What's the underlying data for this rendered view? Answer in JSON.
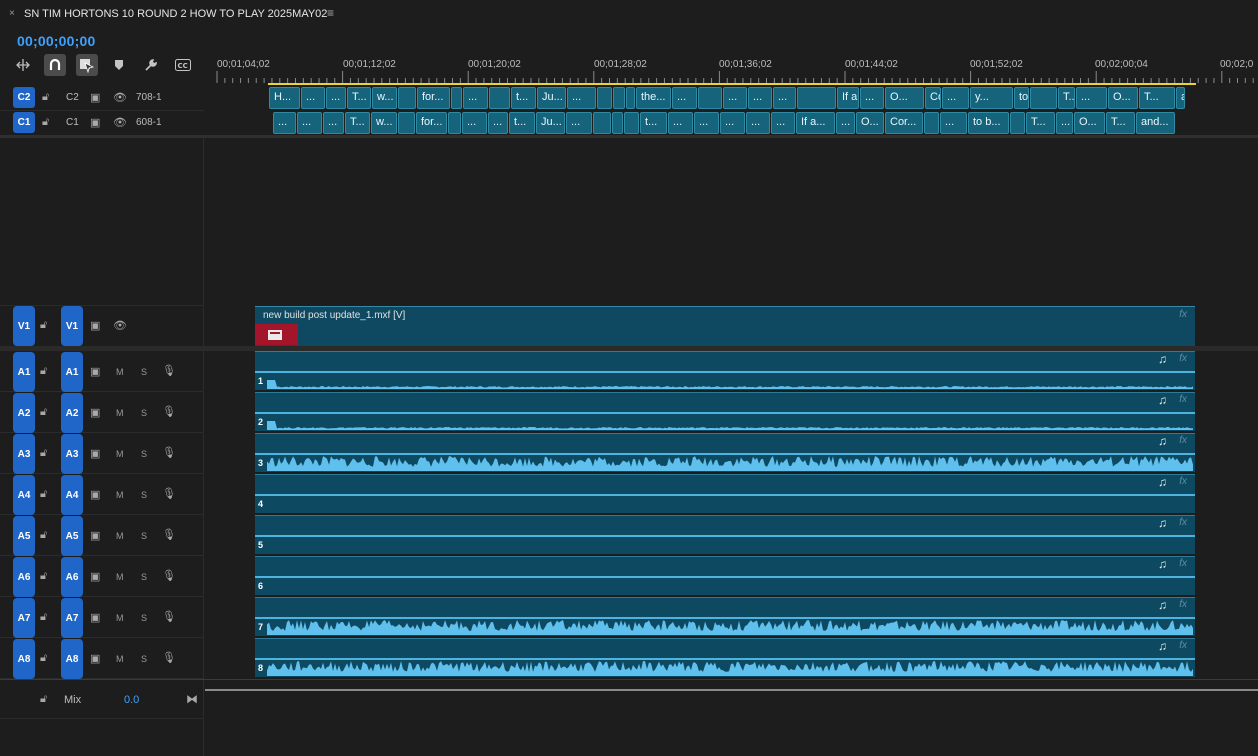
{
  "sequence": {
    "close": "×",
    "title": "SN TIM HORTONS 10 ROUND 2 HOW TO PLAY 2025MAY02",
    "menu_icon": "≡"
  },
  "timecode": "00;00;00;00",
  "toolbar": {
    "icons": [
      "insert-overwrite-icon",
      "snap-icon",
      "linked-selection-icon",
      "add-marker-icon",
      "settings-wrench-icon",
      "captions-icon"
    ]
  },
  "ruler": {
    "labels": [
      "00;01;04;02",
      "00;01;12;02",
      "00;01;20;02",
      "00;01;28;02",
      "00;01;36;02",
      "00;01;44;02",
      "00;01;52;02",
      "00;02;00;04",
      "00;02;0"
    ]
  },
  "caption_tracks": [
    {
      "target": "C2",
      "label": "C2",
      "name": "708-1",
      "clips": [
        "H...",
        "...",
        "...",
        "T...",
        "w...",
        "",
        "for...",
        "",
        "...",
        "",
        "t...",
        "Ju...",
        "...",
        "",
        "",
        "",
        "the...",
        "...",
        "",
        "...",
        "...",
        "...",
        "",
        "If a...",
        "...",
        "O...",
        "Cor...",
        "...",
        "y...",
        "to b...",
        "",
        "T...",
        "...",
        "O...",
        "T...",
        "an..."
      ]
    },
    {
      "target": "C1",
      "label": "C1",
      "name": "608-1",
      "clips": [
        "...",
        "...",
        "...",
        "T...",
        "w...",
        "",
        "for...",
        "",
        "...",
        "...",
        "t...",
        "Ju...",
        "...",
        "",
        "",
        "",
        "t...",
        "...",
        "...",
        "...",
        "...",
        "...",
        "If a...",
        "...",
        "O...",
        "Cor...",
        "",
        "...",
        "to b...",
        "",
        "T...",
        "...",
        "O...",
        "T...",
        "and..."
      ]
    }
  ],
  "video_track": {
    "target": "V1",
    "label": "V1",
    "clip_name": "new build post update_1.mxf [V]",
    "fx": "fx"
  },
  "audio_tracks": [
    {
      "target": "A1",
      "label": "A1",
      "m": "M",
      "s": "S",
      "num": "1",
      "level": "low"
    },
    {
      "target": "A2",
      "label": "A2",
      "m": "M",
      "s": "S",
      "num": "2",
      "level": "low"
    },
    {
      "target": "A3",
      "label": "A3",
      "m": "M",
      "s": "S",
      "num": "3",
      "level": "high"
    },
    {
      "target": "A4",
      "label": "A4",
      "m": "M",
      "s": "S",
      "num": "4",
      "level": "none"
    },
    {
      "target": "A5",
      "label": "A5",
      "m": "M",
      "s": "S",
      "num": "5",
      "level": "none"
    },
    {
      "target": "A6",
      "label": "A6",
      "m": "M",
      "s": "S",
      "num": "6",
      "level": "none"
    },
    {
      "target": "A7",
      "label": "A7",
      "m": "M",
      "s": "S",
      "num": "7",
      "level": "high"
    },
    {
      "target": "A8",
      "label": "A8",
      "m": "M",
      "s": "S",
      "num": "8",
      "level": "high"
    }
  ],
  "audio_fx": "fx",
  "audio_note": "♫",
  "mix": {
    "label": "Mix",
    "value": "0.0"
  },
  "colors": {
    "accent": "#3ea1ff",
    "target": "#1f66c8",
    "clip": "#0d4a62",
    "caption": "#16647b",
    "work_area": "#e5d53a",
    "waveform": "#4fb3e0"
  }
}
